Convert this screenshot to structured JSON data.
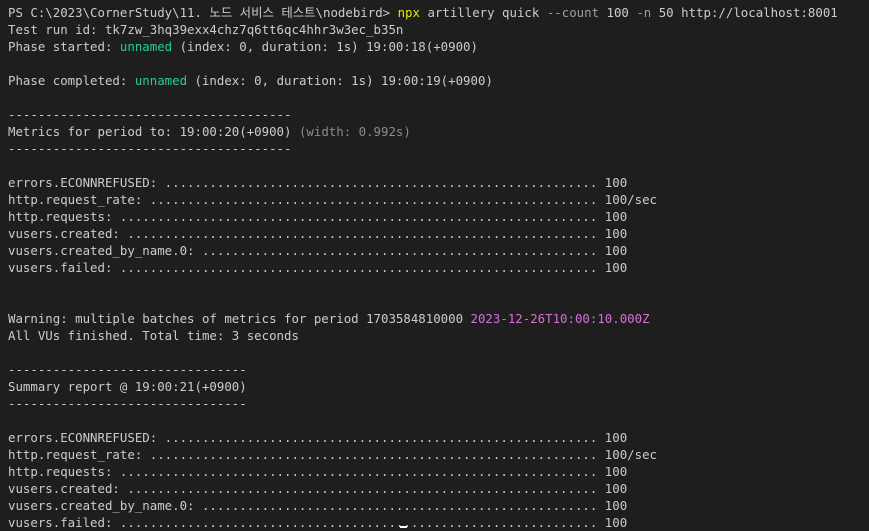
{
  "prompt": {
    "path": "PS C:\\2023\\CornerStudy\\11. 노드 서비스 테스트\\nodebird> ",
    "cmd": "npx",
    "sub": " artillery quick ",
    "flag_count": "--count",
    "count_val": " 100 ",
    "flag_n": "-n",
    "rest": " 50 http://localhost:8001"
  },
  "run_id_line": "Test run id: tk7zw_3hq39exx4chz7q6tt6qc4hhr3w3ec_b35n",
  "phase_started": {
    "prefix": "Phase started: ",
    "name": "unnamed",
    "suffix": " (index: 0, duration: 1s) 19:00:18(+0900)"
  },
  "phase_completed": {
    "prefix": "Phase completed: ",
    "name": "unnamed",
    "suffix": " (index: 0, duration: 1s) 19:00:19(+0900)"
  },
  "period_separator": "--------------------------------------",
  "period_header": {
    "text": "Metrics for period to: 19:00:20(+0900) ",
    "width": "(width: 0.992s)"
  },
  "metrics": [
    {
      "line": "errors.ECONNREFUSED: .......................................................... 100"
    },
    {
      "line": "http.request_rate: ............................................................ 100/sec"
    },
    {
      "line": "http.requests: ................................................................ 100"
    },
    {
      "line": "vusers.created: ............................................................... 100"
    },
    {
      "line": "vusers.created_by_name.0: ..................................................... 100"
    },
    {
      "line": "vusers.failed: ................................................................ 100"
    }
  ],
  "warning": {
    "text": "Warning: multiple batches of metrics for period 1703584810000 ",
    "iso": "2023-12-26T10:00:10.000Z"
  },
  "finished_line": "All VUs finished. Total time: 3 seconds",
  "summary_separator": "--------------------------------",
  "summary_header": "Summary report @ 19:00:21(+0900)",
  "summary_metrics": [
    {
      "line": "errors.ECONNREFUSED: .......................................................... 100"
    },
    {
      "line": "http.request_rate: ............................................................ 100/sec"
    },
    {
      "line": "http.requests: ................................................................ 100"
    },
    {
      "line": "vusers.created: ............................................................... 100"
    },
    {
      "line": "vusers.created_by_name.0: ..................................................... 100"
    },
    {
      "line": "vusers.failed: ................................................................ 100"
    }
  ],
  "colors": {
    "background": "#1e1e1e",
    "text": "#cccccc",
    "command": "#e5e510",
    "flag": "#9d9d9d",
    "phase_name": "#23d18b",
    "dim": "#8b8b8b",
    "iso_timestamp": "#d670d6"
  }
}
